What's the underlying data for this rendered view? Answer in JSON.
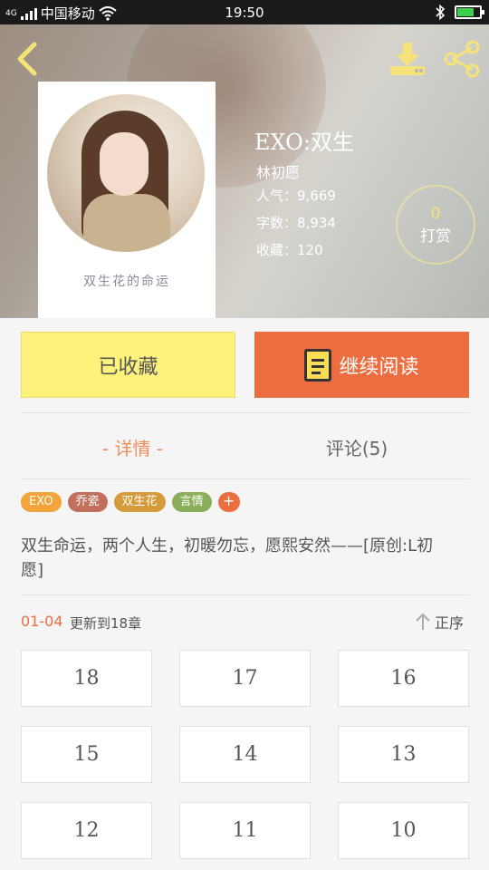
{
  "status_bar": {
    "network_label": "4G",
    "carrier": "中国移动",
    "time": "19:50"
  },
  "book": {
    "title": "EXO:双生",
    "author": "林初愿",
    "popularity": "人气：9,669",
    "word_count": "字数：8,934",
    "favorites": "收藏：120",
    "cover_text": "双生花的命运"
  },
  "tip": {
    "count": "0",
    "label": "打赏"
  },
  "actions": {
    "favorited_label": "已收藏",
    "continue_label": "继续阅读"
  },
  "tabs": {
    "details_label": "-  详情  -",
    "comments_label": "评论(5)"
  },
  "tags": [
    {
      "label": "EXO",
      "color": "#f2a33a"
    },
    {
      "label": "乔瓷",
      "color": "#c0705c"
    },
    {
      "label": "双生花",
      "color": "#d59a3a"
    },
    {
      "label": "言情",
      "color": "#8aae59"
    }
  ],
  "tag_add_label": "+",
  "description": "双生命运，两个人生，初暖勿忘，愿熙安然——[原创:L初愿]",
  "chapters_header": {
    "date": "01-04",
    "update_text": "更新到18章",
    "sort_label": "正序"
  },
  "chapters": [
    "18",
    "17",
    "16",
    "15",
    "14",
    "13",
    "12",
    "11",
    "10"
  ],
  "colors": {
    "accent_orange": "#ec6d40",
    "favorite_yellow": "#fef27c",
    "icon_yellow": "#f5e37a"
  }
}
